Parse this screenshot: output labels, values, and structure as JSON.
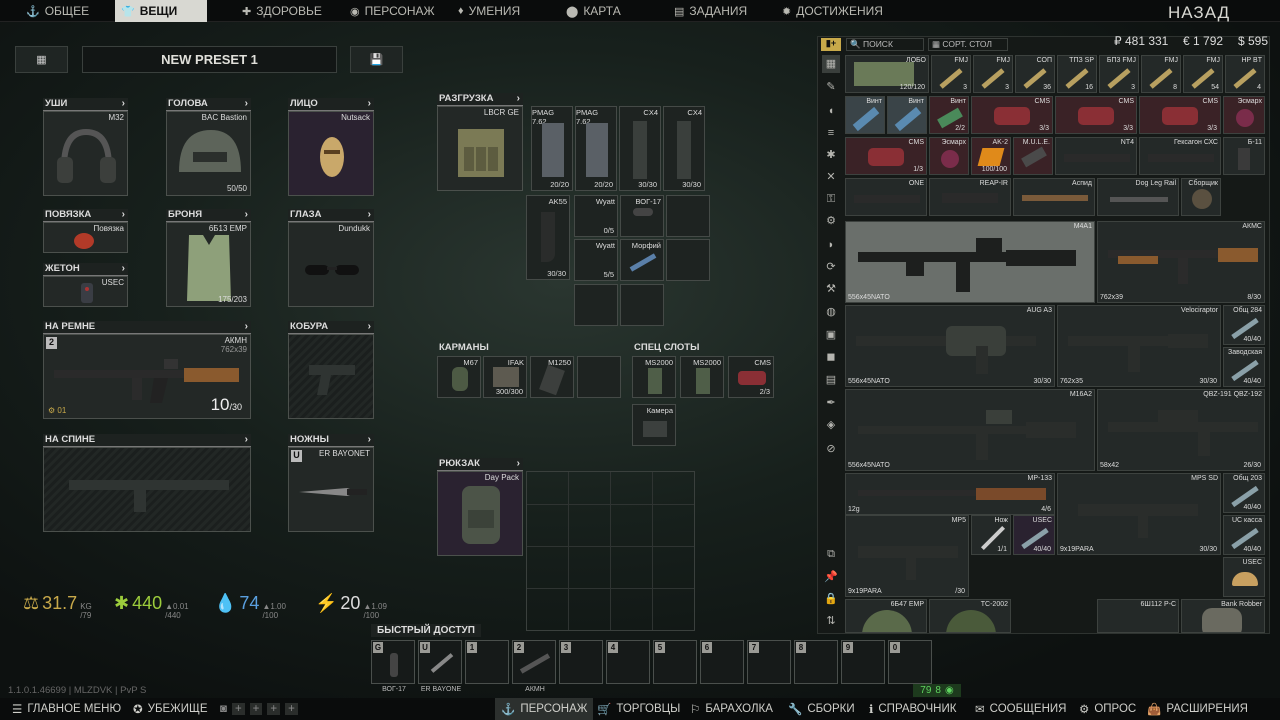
{
  "top_tabs": [
    {
      "label": "ОБЩЕЕ",
      "icon": "anchor-icon"
    },
    {
      "label": "ВЕЩИ",
      "icon": "shirt-icon"
    },
    {
      "label": "ЗДОРОВЬЕ",
      "icon": "health-icon"
    },
    {
      "label": "ПЕРСОНАЖ",
      "icon": "head-icon"
    },
    {
      "label": "УМЕНИЯ",
      "icon": "pin-icon"
    },
    {
      "label": "КАРТА",
      "icon": "map-pin-icon"
    },
    {
      "label": "ЗАДАНИЯ",
      "icon": "tasks-icon"
    },
    {
      "label": "ДОСТИЖЕНИЯ",
      "icon": "gear-badge-icon"
    }
  ],
  "back_label": "НАЗАД",
  "preset_name": "NEW PRESET 1",
  "slots": {
    "ears": {
      "label": "УШИ",
      "item": "M32"
    },
    "head": {
      "label": "ГОЛОВА",
      "item": "BAC Bastion",
      "durability": "50/50"
    },
    "face": {
      "label": "ЛИЦО",
      "item": "Nutsack"
    },
    "armband": {
      "label": "ПОВЯЗКА",
      "item": "Повязка"
    },
    "armor": {
      "label": "БРОНЯ",
      "item": "6Б13 EMP",
      "durability": "175/203"
    },
    "eyes": {
      "label": "ГЛАЗА",
      "item": "Dundukk"
    },
    "token": {
      "label": "ЖЕТОН",
      "item": "USEC"
    },
    "sling": {
      "label": "НА РЕМНЕ",
      "item": "АКМН",
      "caliber": "762x39",
      "ammo": "10",
      "ammo_max": "/30",
      "key": "2",
      "mods": "01"
    },
    "holster": {
      "label": "КОБУРА"
    },
    "back": {
      "label": "НА СПИНЕ"
    },
    "knife": {
      "label": "НОЖНЫ",
      "item": "ER BAYONET",
      "key": "U"
    },
    "rig": {
      "label": "РАЗГРУЗКА",
      "item": "LBCR GE"
    },
    "pockets": {
      "label": "КАРМАНЫ"
    },
    "special": {
      "label": "СПЕЦ СЛОТЫ"
    },
    "backpack": {
      "label": "РЮКЗАК",
      "item": "Day Pack"
    }
  },
  "rig_items": [
    {
      "name": "PMAG 7.62",
      "count": "20/20"
    },
    {
      "name": "PMAG 7.62",
      "count": "20/20"
    },
    {
      "name": "CX4",
      "count": "30/30"
    },
    {
      "name": "CX4",
      "count": "30/30"
    },
    {
      "name": "AK55",
      "count": "30/30"
    },
    {
      "name": "Wyatt",
      "count": "0/5"
    },
    {
      "name": "ВОГ-17",
      "count": ""
    },
    {
      "name": "Wyatt",
      "count": "5/5"
    },
    {
      "name": "Морфий",
      "count": ""
    }
  ],
  "pocket_items": [
    {
      "name": "M67",
      "count": ""
    },
    {
      "name": "IFAK",
      "count": "300/300"
    },
    {
      "name": "M1250",
      "count": ""
    }
  ],
  "special_items": [
    {
      "name": "MS2000"
    },
    {
      "name": "MS2000"
    },
    {
      "name": "CMS",
      "count": "2/3"
    },
    {
      "name": "Камера"
    }
  ],
  "stats": {
    "weight": "31.7",
    "weight_unit": "KG",
    "weight_max": "/79",
    "energy": "440",
    "energy_max": "/440",
    "energy_rate": "▲0.01",
    "hydration": "74",
    "hydration_max": "/100",
    "hydration_rate": "▲1.00",
    "stamina": "20",
    "stamina_max": "/100",
    "stamina_rate": "▲1.09"
  },
  "quick_access": {
    "title": "БЫСТРЫЙ ДОСТУП",
    "slots": [
      {
        "key": "G",
        "label": "ВОГ-17"
      },
      {
        "key": "U",
        "label": "ER BAYONE"
      },
      {
        "key": "1",
        "label": ""
      },
      {
        "key": "2",
        "label": "АКМН"
      },
      {
        "key": "3",
        "label": ""
      },
      {
        "key": "4",
        "label": ""
      },
      {
        "key": "5",
        "label": ""
      },
      {
        "key": "6",
        "label": ""
      },
      {
        "key": "7",
        "label": ""
      },
      {
        "key": "8",
        "label": ""
      },
      {
        "key": "9",
        "label": ""
      },
      {
        "key": "0",
        "label": ""
      }
    ]
  },
  "version": "1.1.0.1.46699 | MLZDVK | PvP S",
  "fps": "79",
  "ping": "8",
  "stash": {
    "search_label": "ПОИСК",
    "sort_label": "СОРТ. СТОЛ",
    "roubles": "₽ 481 331",
    "euros": "€ 1 792",
    "dollars": "$ 595",
    "items": [
      {
        "name": "ЛОБО",
        "count": "120/120"
      },
      {
        "name": "FMJ",
        "count": "3"
      },
      {
        "name": "FMJ",
        "count": "3"
      },
      {
        "name": "СОП",
        "count": "36"
      },
      {
        "name": "ТПЗ SP",
        "count": "16"
      },
      {
        "name": "БП3 FMJ",
        "count": "3"
      },
      {
        "name": "FMJ",
        "count": "8"
      },
      {
        "name": "FMJ",
        "count": "54"
      },
      {
        "name": "HP BT",
        "count": "4"
      },
      {
        "name": "Винт",
        "count": ""
      },
      {
        "name": "Винт",
        "count": ""
      },
      {
        "name": "Винт",
        "count": "2/2"
      },
      {
        "name": "CMS",
        "count": "3/3"
      },
      {
        "name": "CMS",
        "count": "3/3"
      },
      {
        "name": "CMS",
        "count": "3/3"
      },
      {
        "name": "Эсмарх",
        "count": ""
      },
      {
        "name": "CMS",
        "count": "1/3"
      },
      {
        "name": "Эсмарх",
        "count": ""
      },
      {
        "name": "AK-2",
        "count": "100/100"
      },
      {
        "name": "M.U.L.E.",
        "count": ""
      },
      {
        "name": "NT4",
        "count": ""
      },
      {
        "name": "Гексагон СХС",
        "count": ""
      },
      {
        "name": "Б-11",
        "count": ""
      },
      {
        "name": "ONE",
        "count": ""
      },
      {
        "name": "REAP-IR",
        "count": ""
      },
      {
        "name": "Аспид",
        "count": ""
      },
      {
        "name": "Dog Leg Rail",
        "count": ""
      },
      {
        "name": "Сборщик",
        "count": ""
      },
      {
        "name": "M4A1",
        "cal": "556x45NATO",
        "count": ""
      },
      {
        "name": "АКМС",
        "cal": "762x39",
        "count": "8/30"
      },
      {
        "name": "AUG A3",
        "cal": "556x45NATO",
        "count": "30/30"
      },
      {
        "name": "Velociraptor",
        "cal": "762x35",
        "count": "30/30"
      },
      {
        "name": "Общ 284",
        "count": "40/40"
      },
      {
        "name": "Заводская",
        "count": "40/40"
      },
      {
        "name": "M16A2",
        "cal": "556x45NATO",
        "count": ""
      },
      {
        "name": "QBZ-191 QBZ-192",
        "cal": "58x42",
        "count": "26/30"
      },
      {
        "name": "MP-133",
        "cal": "12g",
        "count": "4/6"
      },
      {
        "name": "MPS SD",
        "cal": "9x19PARA",
        "count": "30/30"
      },
      {
        "name": "Общ 203",
        "count": "40/40"
      },
      {
        "name": "UC касса",
        "count": "40/40"
      },
      {
        "name": "MP5",
        "cal": "9x19PARA",
        "count": "/30"
      },
      {
        "name": "Нож",
        "count": "1/1"
      },
      {
        "name": "USEC",
        "count": "40/40"
      },
      {
        "name": "USEC",
        "count": ""
      },
      {
        "name": "6Б47 EMP",
        "count": ""
      },
      {
        "name": "ТС-2002",
        "count": ""
      },
      {
        "name": "6Ш112 Р-С",
        "count": ""
      },
      {
        "name": "Bank Robber",
        "count": ""
      }
    ]
  },
  "bottom_menu": [
    {
      "label": "ГЛАВНОЕ МЕНЮ",
      "icon": "menu-icon"
    },
    {
      "label": "УБЕЖИЩЕ",
      "icon": "hideout-icon"
    },
    {
      "label": "ПЕРСОНАЖ",
      "icon": "character-icon"
    },
    {
      "label": "ТОРГОВЦЫ",
      "icon": "cart-icon"
    },
    {
      "label": "БАРАХОЛКА",
      "icon": "flea-icon"
    },
    {
      "label": "СБОРКИ",
      "icon": "wrench-icon"
    },
    {
      "label": "СПРАВОЧНИК",
      "icon": "book-icon"
    },
    {
      "label": "СООБЩЕНИЯ",
      "icon": "mail-icon"
    },
    {
      "label": "ОПРОС",
      "icon": "gear-icon"
    },
    {
      "label": "РАСШИРЕНИЯ",
      "icon": "bag-icon"
    }
  ],
  "colors": {
    "gold": "#c8a94a",
    "green": "#3fae3f",
    "red": "#e05555",
    "active_tab": "#d8d8d2"
  }
}
